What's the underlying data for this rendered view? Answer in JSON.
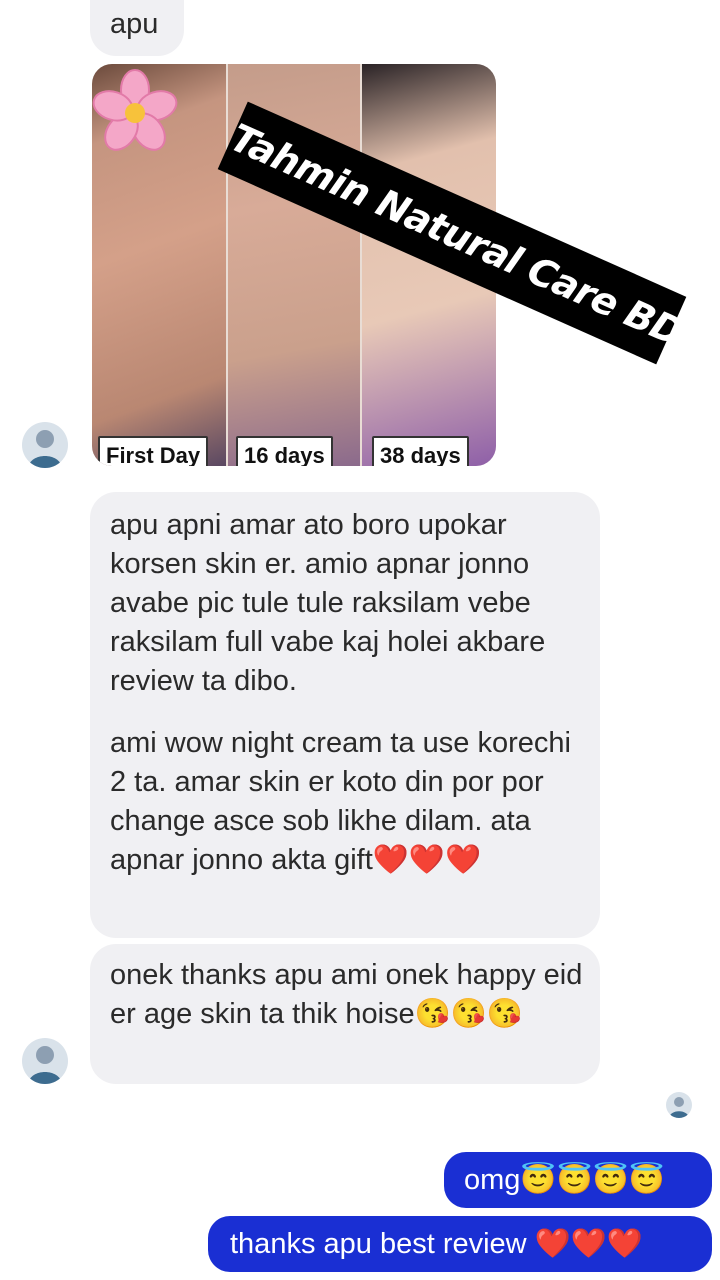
{
  "messages": {
    "top_bubble": "apu",
    "review_paragraph_1": "apu apni amar ato boro upokar korsen skin er. amio apnar jonno avabe pic tule tule raksilam vebe raksilam full vabe kaj holei akbare review ta dibo.",
    "review_paragraph_2": "ami wow night cream ta use korechi  2 ta. amar skin er koto din por por change asce sob likhe dilam. ata apnar jonno akta gift❤️❤️❤️",
    "thanks_bubble": "onek thanks apu ami onek happy eid er age skin ta thik hoise😘😘😘",
    "reply_1": "omg😇😇😇😇",
    "reply_2": "thanks apu best review ❤️❤️❤️"
  },
  "photo": {
    "labels": [
      "First Day",
      "16 days",
      "38 days"
    ],
    "watermark": "Tahmin Natural Care BD"
  },
  "colors": {
    "incoming_bubble": "#f0f0f3",
    "outgoing_bubble": "#1a2fd3",
    "watermark_bg": "#000000"
  },
  "icons": {
    "flower": "pink-flower-sticker",
    "avatar": "contact-avatar"
  }
}
